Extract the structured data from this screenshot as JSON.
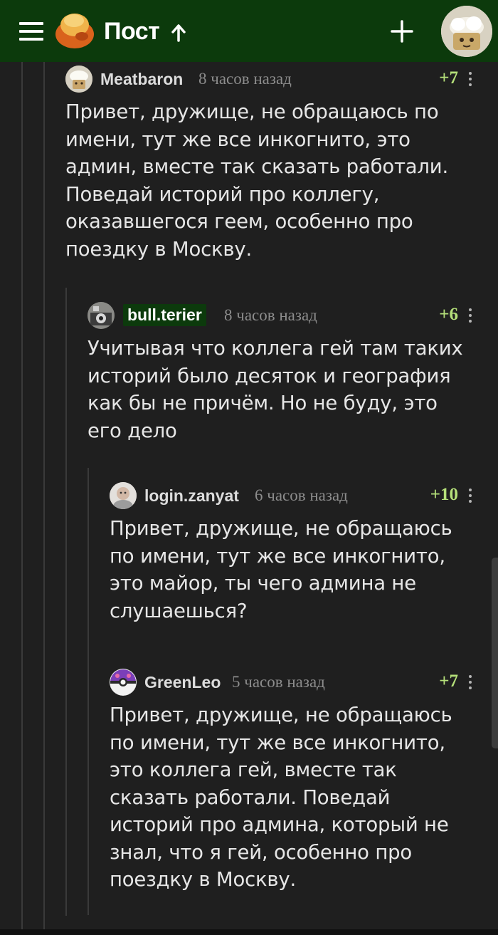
{
  "header": {
    "title": "Пост",
    "brand_color": "#0c3a0c",
    "menu_icon": "hamburger-menu-icon",
    "logo_icon": "pikabu-logo-icon",
    "sort_icon": "arrow-up-icon",
    "add_icon": "plus-icon",
    "avatar_icon": "user-avatar"
  },
  "comments": [
    {
      "author": "Meatbaron",
      "time": "8 часов назад",
      "rating": "+7",
      "text": "Привет, дружище, не обращаюсь по имени, тут же все инкогнито, это админ, вместе так сказать работали. Поведай историй про коллегу, оказавшегося геем, особенно про поездку в Москву."
    },
    {
      "author": "bull.terier",
      "time": "8 часов назад",
      "rating": "+6",
      "text": "Учитывая что коллега гей там таких историй было десяток и география как бы не причём. Но не буду, это его дело"
    },
    {
      "author": "login.zanyat",
      "time": "6 часов назад",
      "rating": "+10",
      "text": "Привет, дружище, не обращаюсь по имени, тут же все инкогнито, это майор, ты чего админа не слушаешься?"
    },
    {
      "author": "GreenLeo",
      "time": "5 часов назад",
      "rating": "+7",
      "text": "Привет, дружище, не обращаюсь по имени, тут же все инкогнито, это коллега гей, вместе так сказать работали. Поведай историй про админа, который не знал, что я гей, особенно про поездку в Москву."
    }
  ],
  "colors": {
    "background": "#1f1f1f",
    "rating": "#b5e07a",
    "thread_line": "#3a3a3a"
  }
}
